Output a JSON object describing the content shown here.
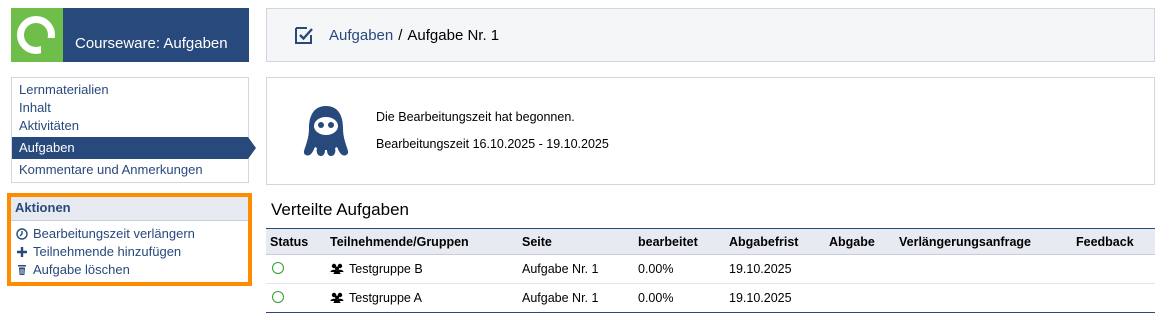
{
  "brand": {
    "title": "Courseware: Aufgaben",
    "color": "#28497c",
    "logo_color": "#6ebe49"
  },
  "nav": {
    "items": [
      {
        "label": "Lernmaterialien",
        "active": false
      },
      {
        "label": "Inhalt",
        "active": false
      },
      {
        "label": "Aktivitäten",
        "active": false
      },
      {
        "label": "Aufgaben",
        "active": true
      },
      {
        "label": "Kommentare und Anmerkungen",
        "active": false
      }
    ]
  },
  "actions": {
    "title": "Aktionen",
    "items": [
      {
        "icon": "clock-icon",
        "label": "Bearbeitungszeit verlängern"
      },
      {
        "icon": "plus-icon",
        "label": "Teilnehmende hinzufügen"
      },
      {
        "icon": "trash-icon",
        "label": "Aufgabe löschen"
      }
    ],
    "highlight_color": "#ff8c00"
  },
  "breadcrumb": {
    "icon": "task-checkbox-icon",
    "link": "Aufgaben",
    "separator": "/",
    "current": "Aufgabe Nr. 1"
  },
  "info": {
    "icon": "mascot-icon",
    "line1": "Die Bearbeitungszeit hat begonnen.",
    "line2": "Bearbeitungszeit 16.10.2025 - 19.10.2025"
  },
  "tasks": {
    "title": "Verteilte Aufgaben",
    "headers": [
      "Status",
      "Teilnehmende/Gruppen",
      "Seite",
      "bearbeitet",
      "Abgabefrist",
      "Abgabe",
      "Verlängerungsanfrage",
      "Feedback"
    ],
    "rows": [
      {
        "status": "status-circle-icon",
        "group_icon": "group-icon",
        "group": "Testgruppe B",
        "page": "Aufgabe Nr. 1",
        "progress": "0.00%",
        "deadline": "19.10.2025",
        "submission": "",
        "extension": "",
        "feedback": ""
      },
      {
        "status": "status-circle-icon",
        "group_icon": "group-icon",
        "group": "Testgruppe A",
        "page": "Aufgabe Nr. 1",
        "progress": "0.00%",
        "deadline": "19.10.2025",
        "submission": "",
        "extension": "",
        "feedback": ""
      }
    ]
  }
}
